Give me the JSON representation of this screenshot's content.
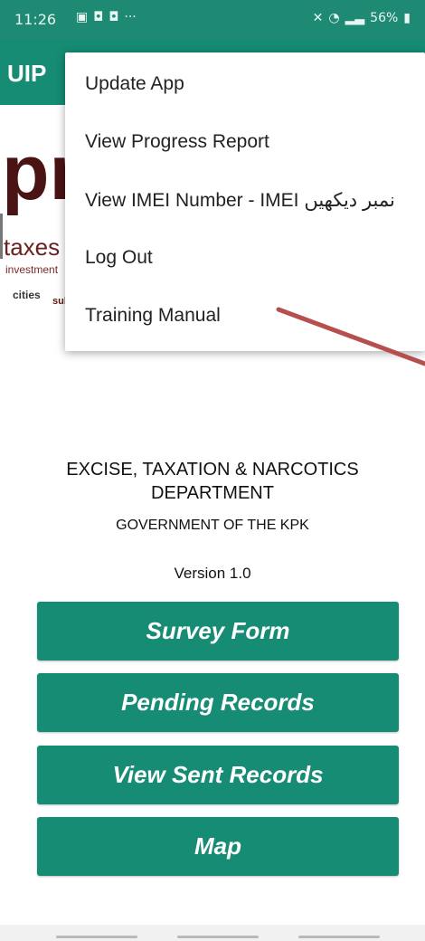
{
  "status_bar": {
    "time": "11:26",
    "dots": "···",
    "battery": "56%"
  },
  "app_bar": {
    "title": "UIP"
  },
  "hero": {
    "words": [
      "pr",
      "taxes",
      "investment",
      "cities",
      "sul"
    ]
  },
  "menu": {
    "items": [
      "Update App",
      "View Progress Report",
      "View IMEI Number - IMEI نمبر دیکھیں",
      "Log Out",
      "Training Manual"
    ]
  },
  "header": {
    "department": "EXCISE, TAXATION & NARCOTICS DEPARTMENT",
    "government": "GOVERNMENT OF THE KPK",
    "version": "Version 1.0"
  },
  "buttons": {
    "survey_form": "Survey Form",
    "pending_records": "Pending Records",
    "view_sent_records": "View Sent Records",
    "map": "Map"
  },
  "colors": {
    "primary": "#168c74",
    "status_bar": "#1f8a74",
    "arrow": "#b5504f"
  }
}
